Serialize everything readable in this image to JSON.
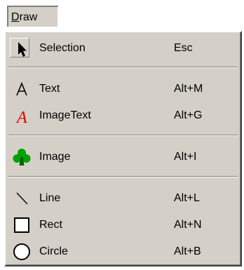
{
  "menubar": {
    "menu": {
      "label_underlined": "D",
      "label_rest": "raw"
    }
  },
  "items": [
    {
      "label": "Selection",
      "shortcut": "Esc",
      "icon": "arrow-cursor-icon"
    },
    {
      "label": "Text",
      "shortcut": "Alt+M",
      "icon": "text-a-icon"
    },
    {
      "label": "ImageText",
      "shortcut": "Alt+G",
      "icon": "italic-red-a-icon"
    },
    {
      "label": "Image",
      "shortcut": "Alt+I",
      "icon": "green-club-icon"
    },
    {
      "label": "Line",
      "shortcut": "Alt+L",
      "icon": "diagonal-line-icon"
    },
    {
      "label": "Rect",
      "shortcut": "Alt+N",
      "icon": "square-outline-icon"
    },
    {
      "label": "Circle",
      "shortcut": "Alt+B",
      "icon": "circle-outline-icon"
    }
  ],
  "colors": {
    "menu_bg": "#d4d0c8",
    "image_text_icon": "#e00000",
    "club_icon": "#00a000"
  }
}
